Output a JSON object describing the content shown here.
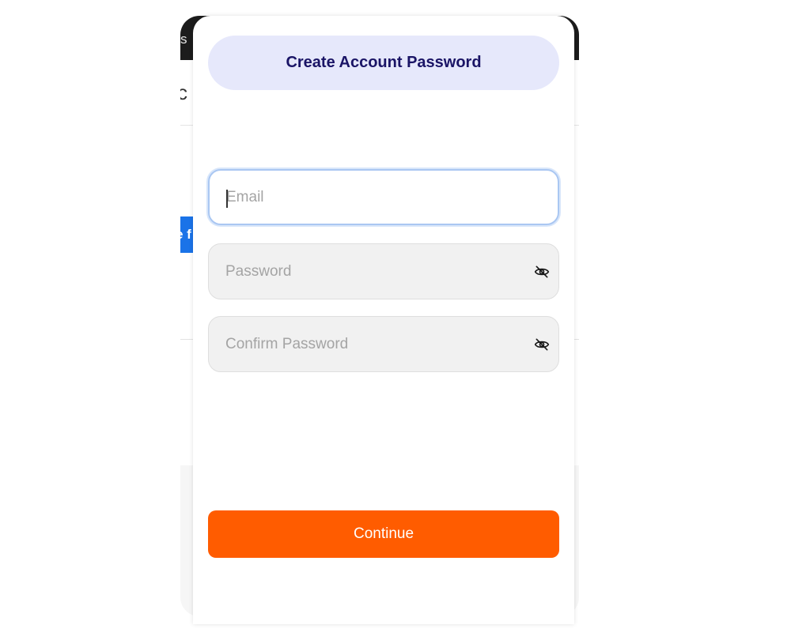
{
  "background_app": {
    "topbar_fragment": "s",
    "header_fragment": "c",
    "button_fragment": "e f"
  },
  "modal": {
    "title": "Create Account Password",
    "email": {
      "value": "",
      "placeholder": "Email"
    },
    "password": {
      "value": "",
      "placeholder": "Password",
      "icon": "eye-off-icon"
    },
    "confirm_password": {
      "value": "",
      "placeholder": "Confirm Password",
      "icon": "eye-off-icon"
    },
    "continue_label": "Continue"
  },
  "colors": {
    "accent": "#ff5c00",
    "title_pill": "#e6e8fb",
    "title_text": "#1a1466",
    "focus_border": "#aac7f2"
  }
}
